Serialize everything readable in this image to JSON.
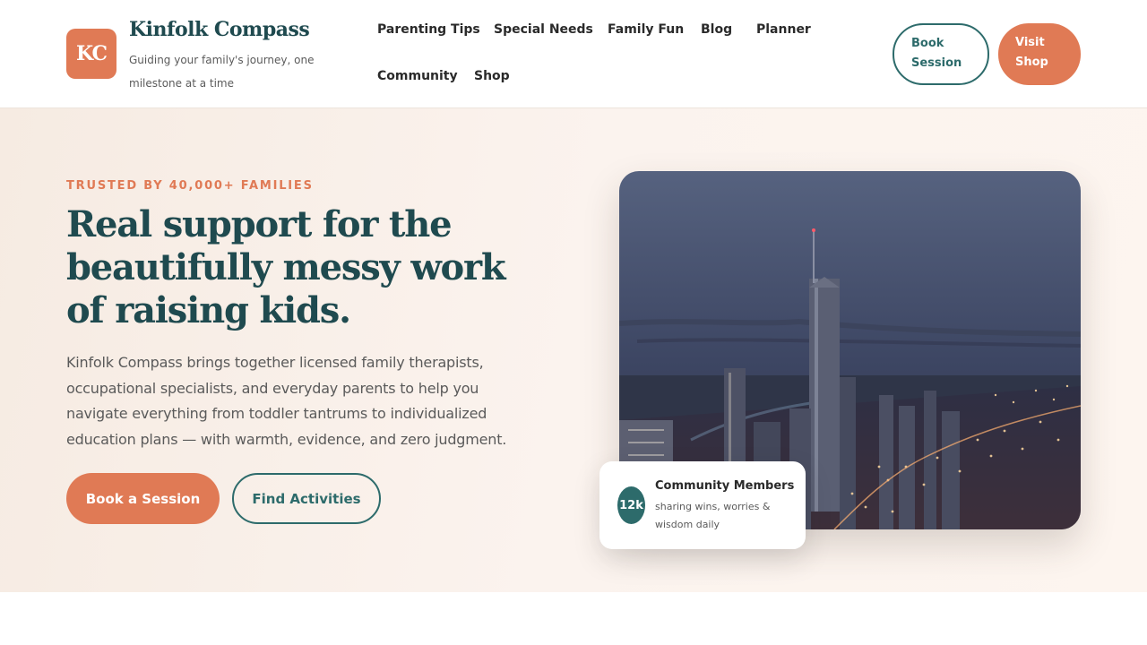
{
  "brand": {
    "initials": "KC",
    "name": "Kinfolk Compass",
    "tagline": "Guiding your family's journey, one milestone at a time",
    "accent": "#e07a55",
    "primary": "#1f4a4f",
    "teal": "#2d6b6b"
  },
  "nav": {
    "items": [
      {
        "label": "Parenting Tips"
      },
      {
        "label": "Special Needs"
      },
      {
        "label": "Family Fun"
      },
      {
        "label": "Blog"
      },
      {
        "label": "Planner"
      },
      {
        "label": "Community"
      },
      {
        "label": "Shop"
      }
    ]
  },
  "header_actions": {
    "book_line1": "Book",
    "book_line2": "Session",
    "visit_line1": "Visit",
    "visit_line2": "Shop"
  },
  "hero": {
    "eyebrow": "TRUSTED BY 40,000+ FAMILIES",
    "headline": "Real support for the beautifully messy work of raising kids.",
    "lead": "Kinfolk Compass brings together licensed family therapists, occupational specialists, and everyday parents to help you navigate everything from toddler tantrums to individualized education plans — with warmth, evidence, and zero judgment.",
    "primary_cta": "Book a Session",
    "secondary_cta": "Find Activities"
  },
  "stat": {
    "value": "12k",
    "title": "Community Members",
    "subtitle": "sharing wins, worries & wisdom daily"
  }
}
